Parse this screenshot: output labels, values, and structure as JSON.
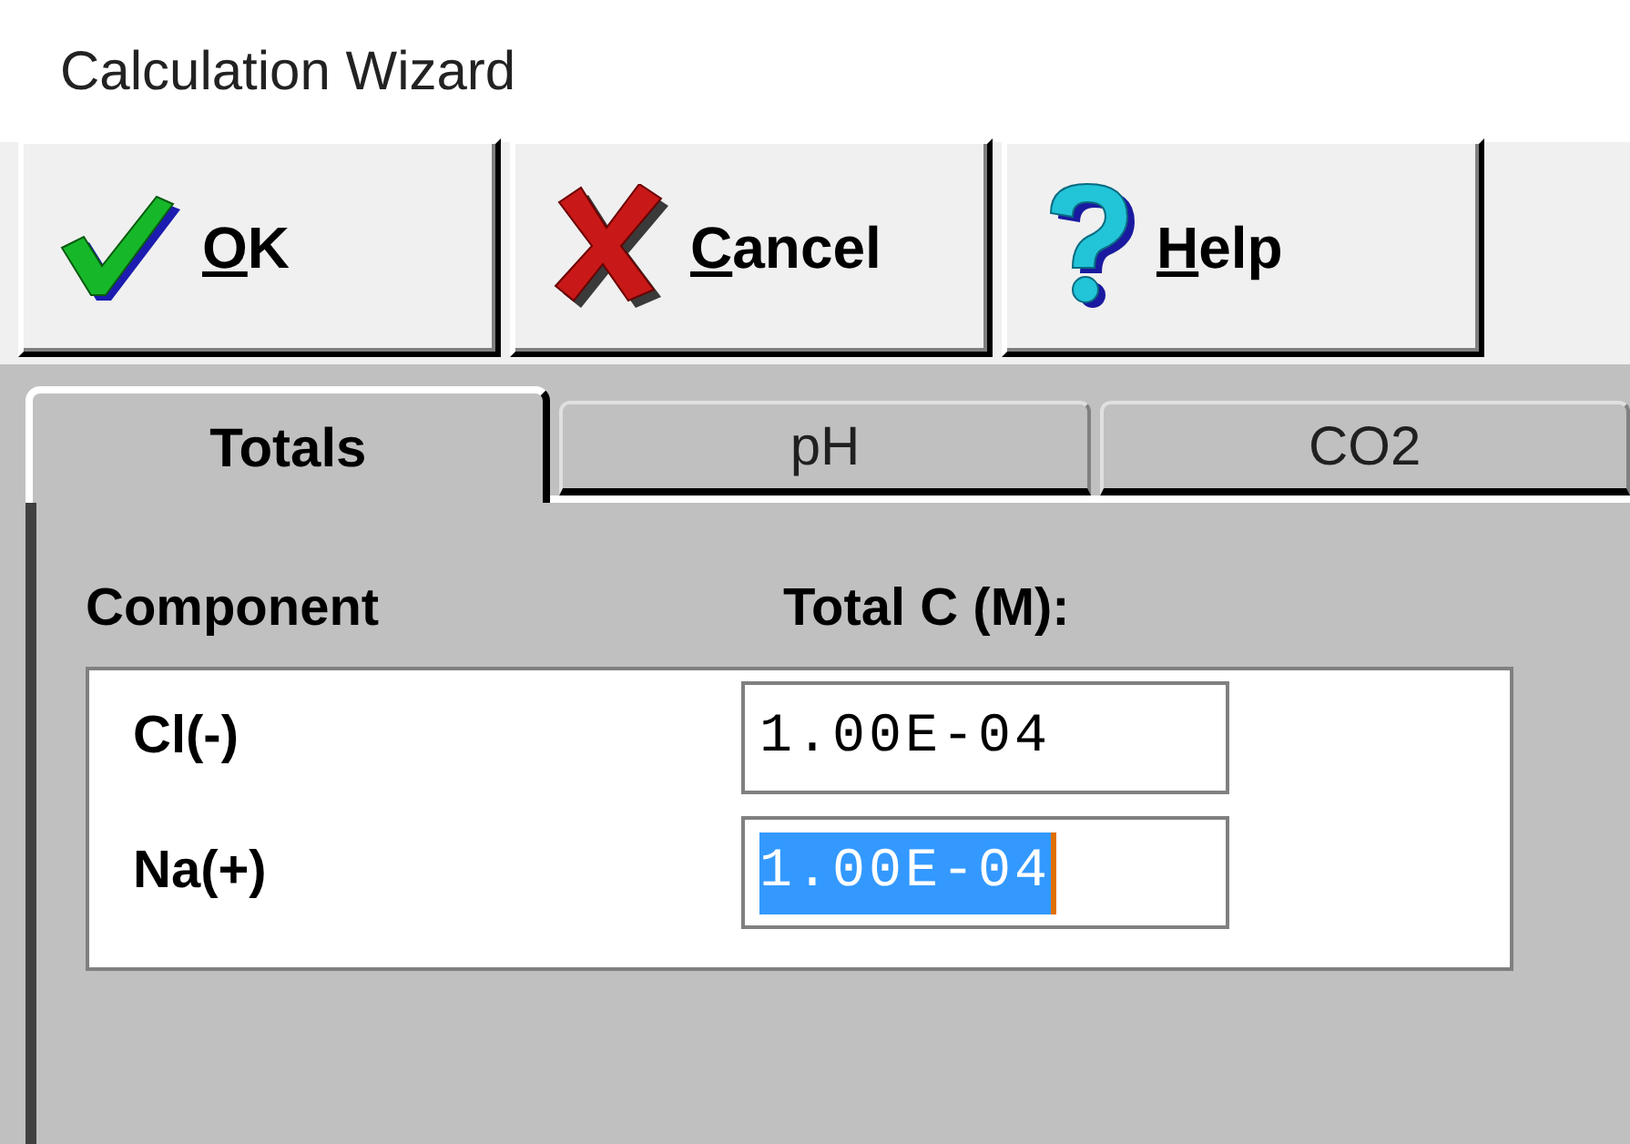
{
  "window": {
    "title": "Calculation Wizard"
  },
  "buttons": [
    {
      "label": "OK",
      "kind": "ok",
      "underline_first": true
    },
    {
      "label": "Cancel",
      "kind": "cancel",
      "underline_first": true
    },
    {
      "label": "Help",
      "kind": "help",
      "underline_first": true
    }
  ],
  "tabs": [
    {
      "label": "Totals",
      "selected": true
    },
    {
      "label": "pH",
      "selected": false
    },
    {
      "label": "CO2",
      "selected": false
    }
  ],
  "table": {
    "columns": [
      "Component",
      "Total C (M):"
    ],
    "rows": [
      {
        "component": "Cl(-)",
        "value": "1.00E-04",
        "selected": false
      },
      {
        "component": "Na(+)",
        "value": "1.00E-04",
        "selected": true
      }
    ]
  }
}
